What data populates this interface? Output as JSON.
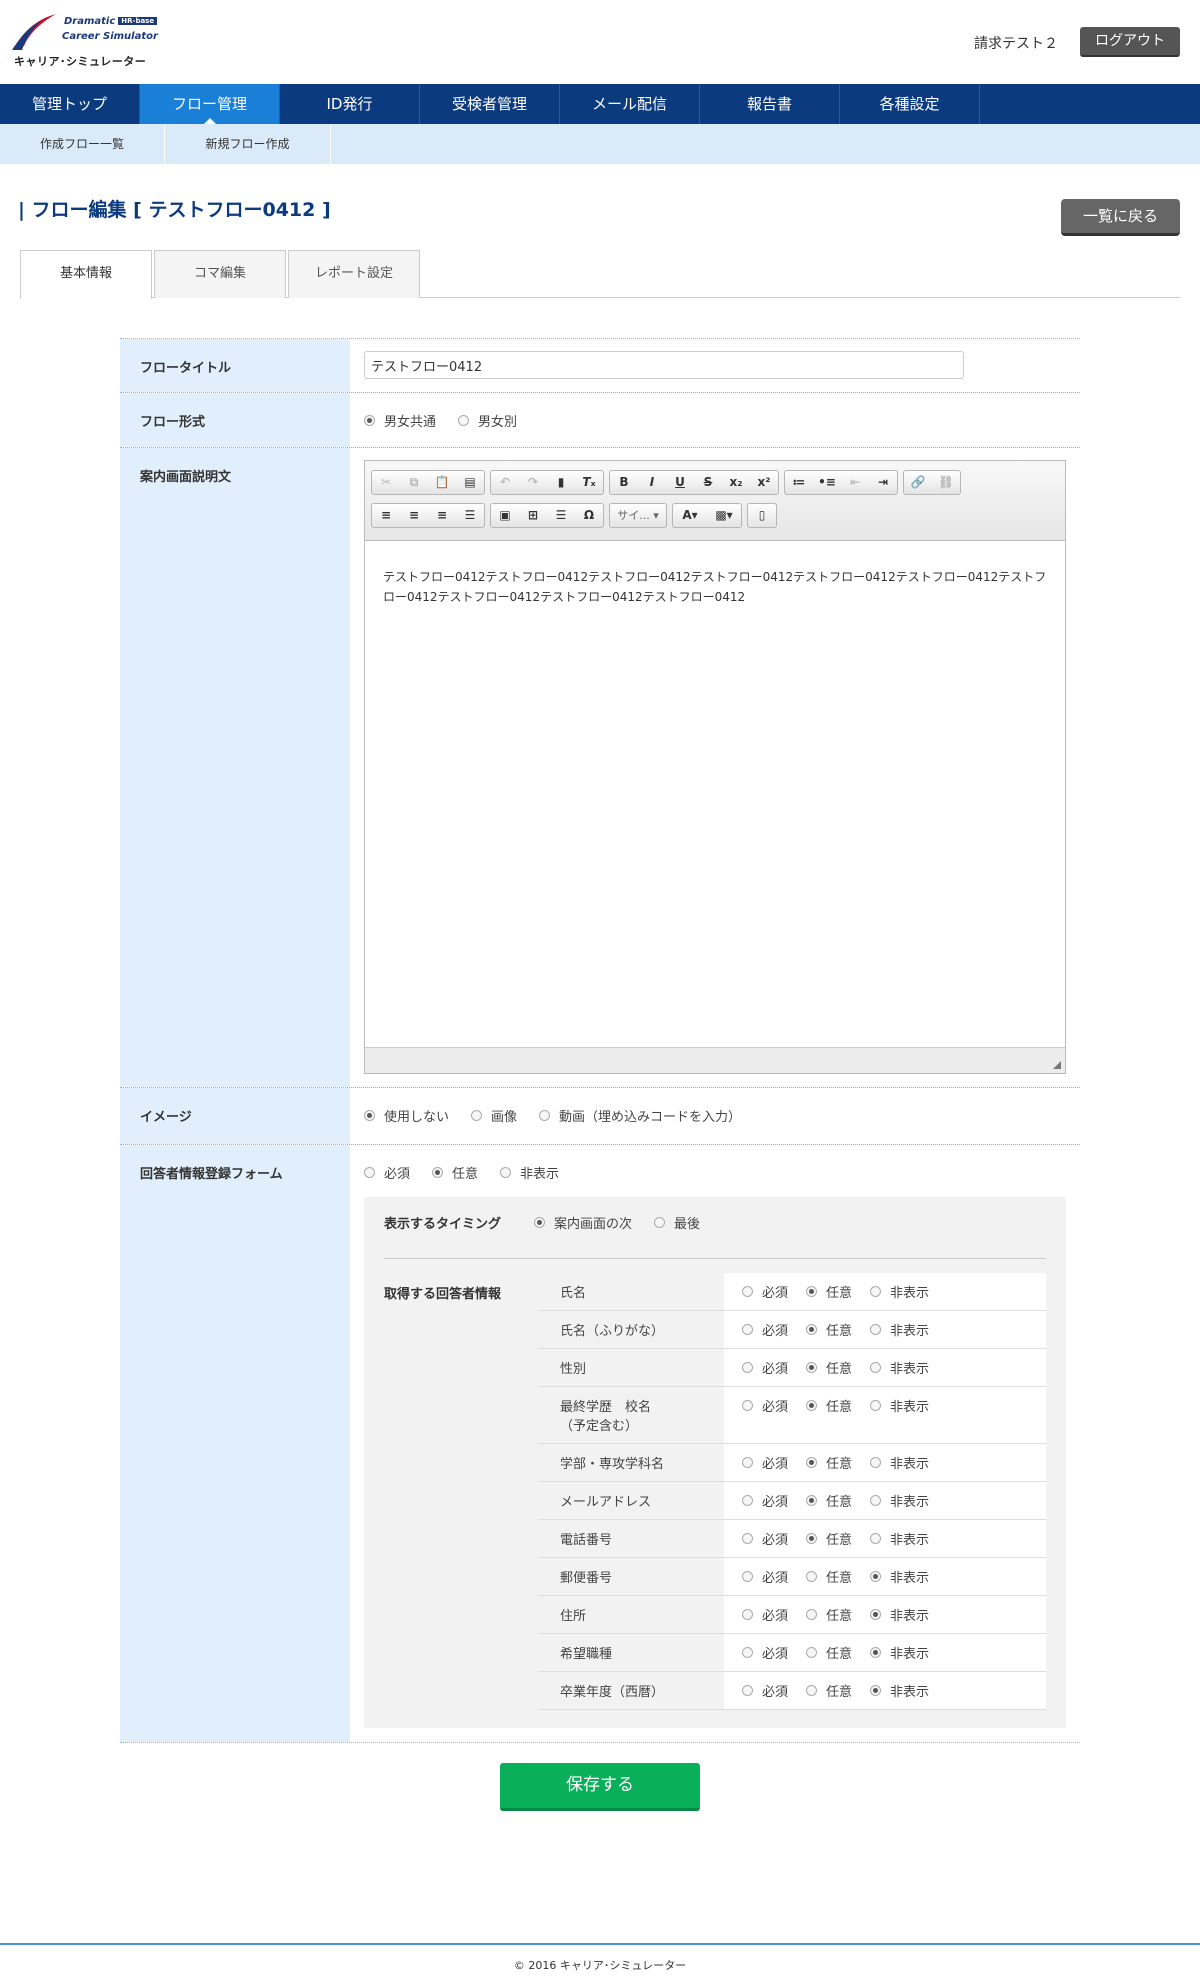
{
  "header": {
    "logo_line1": "Dramatic",
    "logo_badge": "HR-base",
    "logo_line2": "Career Simulator",
    "logo_line3": "キャリア･シミュレーター",
    "user_name": "請求テスト２",
    "logout_label": "ログアウト"
  },
  "nav": [
    {
      "label": "管理トップ"
    },
    {
      "label": "フロー管理"
    },
    {
      "label": "ID発行"
    },
    {
      "label": "受検者管理"
    },
    {
      "label": "メール配信"
    },
    {
      "label": "報告書"
    },
    {
      "label": "各種設定"
    }
  ],
  "subnav": [
    {
      "label": "作成フロー一覧"
    },
    {
      "label": "新規フロー作成"
    }
  ],
  "page": {
    "title": "| フロー編集 [ テストフロー0412 ]",
    "back_label": "一覧に戻る"
  },
  "tabs": [
    {
      "label": "基本情報"
    },
    {
      "label": "コマ編集"
    },
    {
      "label": "レポート設定"
    }
  ],
  "form": {
    "title_label": "フロータイトル",
    "title_value": "テストフロー0412",
    "format_label": "フロー形式",
    "format_options": [
      "男女共通",
      "男女別"
    ],
    "description_label": "案内画面説明文",
    "editor_text": "テストフロー0412テストフロー0412テストフロー0412テストフロー0412テストフロー0412テストフロー0412テストフロー0412テストフロー0412テストフロー0412テストフロー0412",
    "editor_combo": "サイ...",
    "image_label": "イメージ",
    "image_options": [
      "使用しない",
      "画像",
      "動画（埋め込みコードを入力）"
    ],
    "respondent_label": "回答者情報登録フォーム",
    "respondent_options": [
      "必須",
      "任意",
      "非表示"
    ],
    "timing_label": "表示するタイミング",
    "timing_options": [
      "案内画面の次",
      "最後"
    ],
    "info_label": "取得する回答者情報",
    "opt_required": "必須",
    "opt_optional": "任意",
    "opt_hidden": "非表示",
    "fields": [
      {
        "name": "氏名",
        "selected": 1
      },
      {
        "name": "氏名（ふりがな）",
        "selected": 1
      },
      {
        "name": "性別",
        "selected": 1
      },
      {
        "name": "最終学歴　校名\n（予定含む）",
        "selected": 1
      },
      {
        "name": "学部・専攻学科名",
        "selected": 1
      },
      {
        "name": "メールアドレス",
        "selected": 1
      },
      {
        "name": "電話番号",
        "selected": 1
      },
      {
        "name": "郵便番号",
        "selected": 2
      },
      {
        "name": "住所",
        "selected": 2
      },
      {
        "name": "希望職種",
        "selected": 2
      },
      {
        "name": "卒業年度（西暦）",
        "selected": 2
      }
    ]
  },
  "save_label": "保存する",
  "footer": "© 2016 キャリア･シミュレーター"
}
